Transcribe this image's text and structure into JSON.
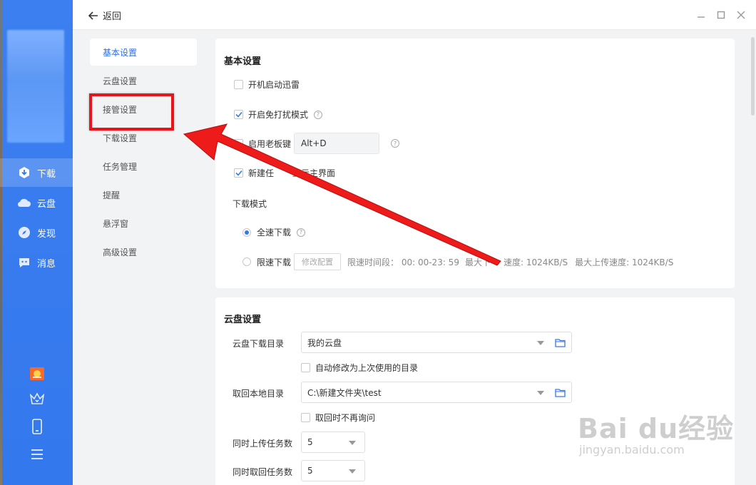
{
  "topbar": {
    "back_label": "返回"
  },
  "sidebar": {
    "items": [
      {
        "label": "下载",
        "icon": "download-icon",
        "active": true
      },
      {
        "label": "云盘",
        "icon": "cloud-icon",
        "active": false
      },
      {
        "label": "发现",
        "icon": "compass-icon",
        "active": false
      },
      {
        "label": "消息",
        "icon": "message-icon",
        "active": false
      }
    ],
    "bottom_icons": [
      "gift-icon",
      "crown-icon",
      "phone-icon",
      "menu-icon"
    ]
  },
  "settings_nav": {
    "items": [
      {
        "label": "基本设置",
        "active": true
      },
      {
        "label": "云盘设置"
      },
      {
        "label": "接管设置",
        "highlighted": true
      },
      {
        "label": "下载设置"
      },
      {
        "label": "任务管理"
      },
      {
        "label": "提醒"
      },
      {
        "label": "悬浮窗"
      },
      {
        "label": "高级设置"
      }
    ]
  },
  "basic": {
    "title": "基本设置",
    "autostart": {
      "label": "开机启动迅雷",
      "checked": false
    },
    "dnd": {
      "label": "开启免打扰模式",
      "checked": true
    },
    "boss_key": {
      "label": "启用老板键",
      "checked": false,
      "value": "Alt+D"
    },
    "new_task": {
      "label_left": "新建任",
      "label_right": "显示主界面",
      "checked": true
    },
    "download_mode": {
      "title": "下载模式",
      "full_speed": {
        "label": "全速下载",
        "selected": true
      },
      "limited": {
        "label": "限速下载",
        "selected": false,
        "button": "修改配置",
        "period": "限速时间段： 00: 00-23: 59",
        "max_down_a": "最大下",
        "max_down_b": "速度: 1024KB/S",
        "max_up": "最大上传速度: 1024KB/S"
      }
    }
  },
  "cloud": {
    "title": "云盘设置",
    "download_dir": {
      "label": "云盘下载目录",
      "value": "我的云盘"
    },
    "auto_modify": {
      "label": "自动修改为上次使用的目录",
      "checked": false
    },
    "local_dir": {
      "label": "取回本地目录",
      "value": "C:\\新建文件夹\\test"
    },
    "no_ask": {
      "label": "取回时不再询问",
      "checked": false
    },
    "upload_tasks": {
      "label": "同时上传任务数",
      "value": "5"
    },
    "retrieve_tasks": {
      "label": "同时取回任务数",
      "value": "5"
    }
  },
  "watermark": {
    "main": "Bai du经验",
    "sub": "jingyan.baidu.com"
  },
  "colors": {
    "accent": "#3478ee",
    "highlight": "#e8141b"
  }
}
